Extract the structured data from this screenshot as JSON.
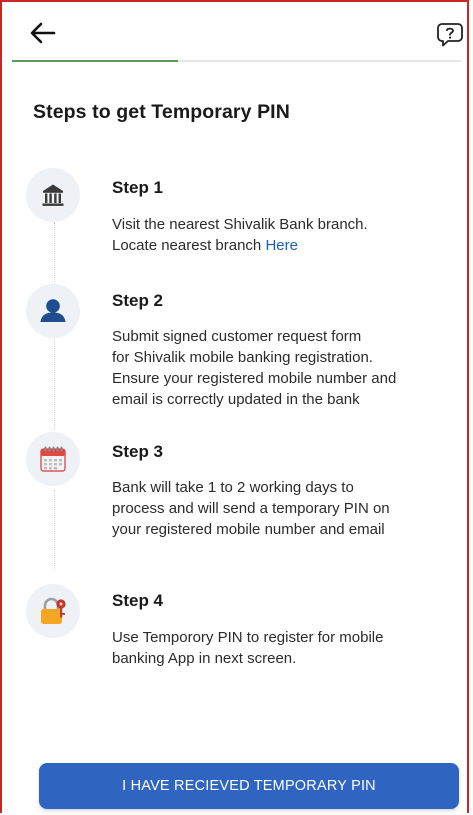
{
  "header": {
    "back_icon": "arrow-left-icon",
    "help_icon": "help-chat-icon",
    "progress": 0.37,
    "progress_color": "#5c9a5f"
  },
  "page": {
    "title": "Steps to get Temporary PIN"
  },
  "steps": [
    {
      "icon": "bank-icon",
      "title": "Step 1",
      "lines": [
        "Visit the nearest Shivalik Bank branch."
      ],
      "link_prefix": "Locate nearest branch ",
      "link_text": "Here"
    },
    {
      "icon": "user-icon",
      "title": "Step 2",
      "lines": [
        "Submit signed customer request form",
        "for Shivalik mobile banking registration.",
        "Ensure your registered mobile number and",
        "email is correctly updated in the bank"
      ]
    },
    {
      "icon": "calendar-icon",
      "title": "Step 3",
      "lines": [
        "Bank will take 1 to 2 working days to",
        "process and will send a temporary PIN on",
        "your registered mobile number and email"
      ]
    },
    {
      "icon": "lock-key-icon",
      "title": "Step 4",
      "lines": [
        "Use Temporory PIN to register for mobile",
        "banking App in next screen."
      ]
    }
  ],
  "cta": {
    "label": "I HAVE RECIEVED TEMPORARY PIN",
    "color": "#2f65c1"
  }
}
